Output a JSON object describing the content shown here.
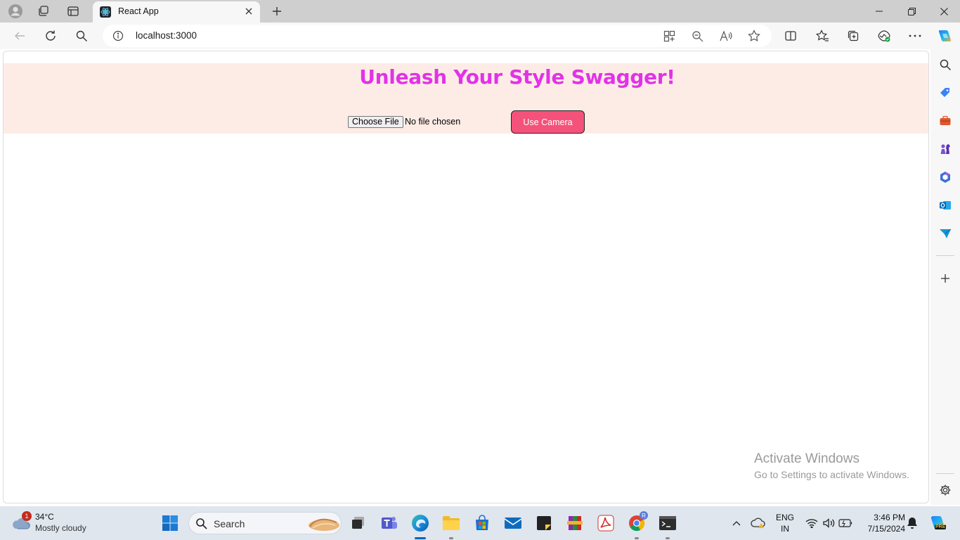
{
  "browser": {
    "tab": {
      "title": "React App"
    },
    "address": {
      "url": "localhost:3000"
    }
  },
  "page": {
    "heading": "Unleash Your Style Swagger!",
    "file_input": {
      "button_label": "Choose File",
      "status": "No file chosen"
    },
    "camera_button": {
      "label": "Use Camera",
      "color": "#f4527a"
    },
    "banner_color": "#fdece6",
    "heading_color": "#e232e8"
  },
  "watermark": {
    "line1": "Activate Windows",
    "line2": "Go to Settings to activate Windows."
  },
  "taskbar": {
    "weather": {
      "badge": "1",
      "temp": "34°C",
      "condition": "Mostly cloudy"
    },
    "search_label": "Search",
    "language": {
      "line1": "ENG",
      "line2": "IN"
    },
    "clock": {
      "time": "3:46 PM",
      "date": "7/15/2024"
    },
    "chrome_profile_badge": "R",
    "copilot_badge": "PRE"
  }
}
